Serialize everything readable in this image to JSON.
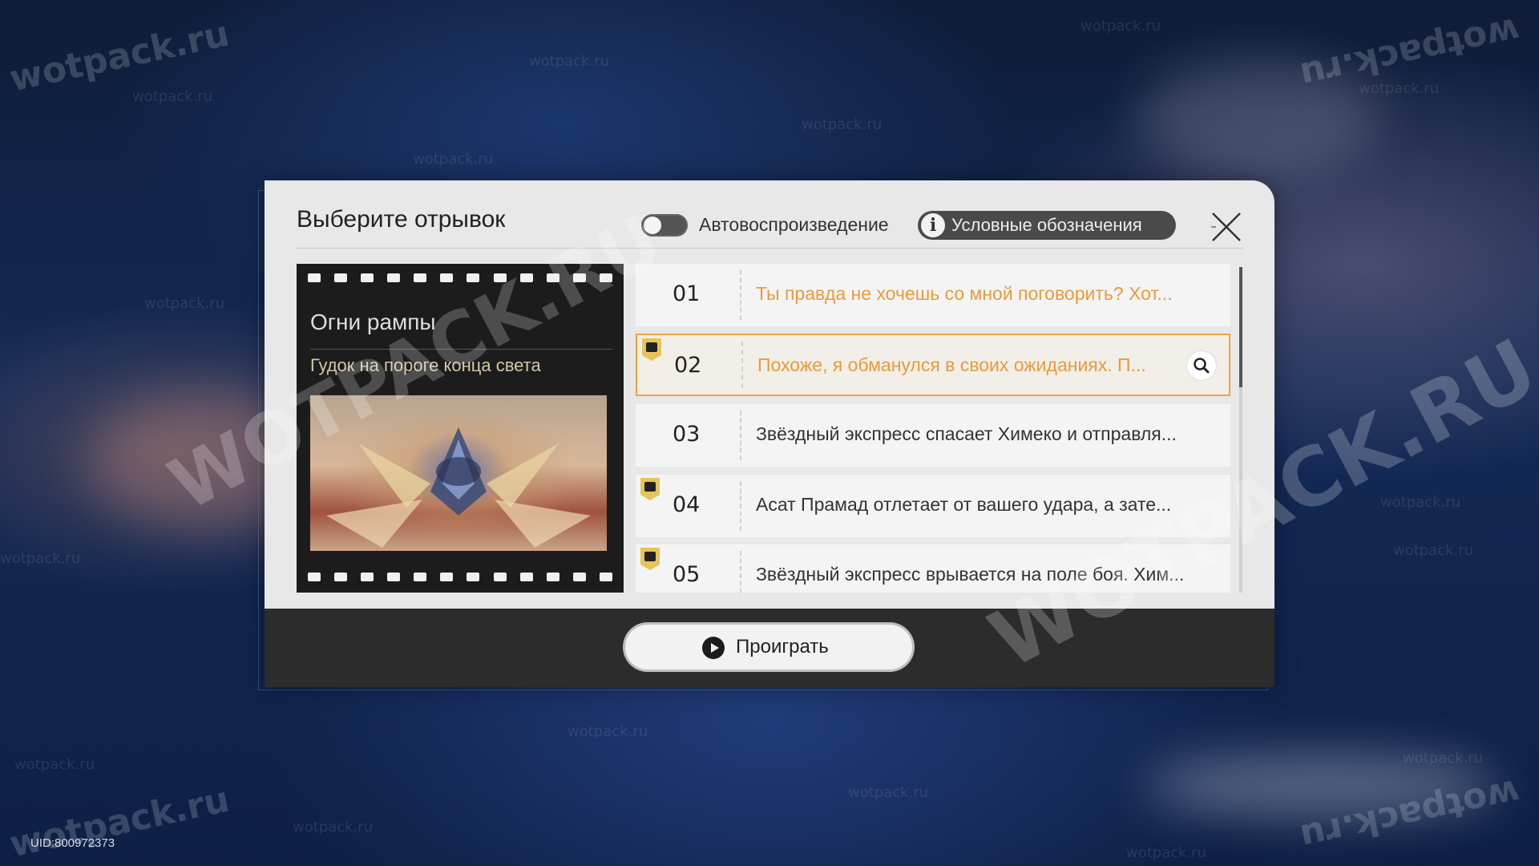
{
  "dialog": {
    "title": "Выберите отрывок",
    "autoplay_label": "Автовоспроизведение",
    "autoplay_on": false,
    "legend_label": "Условные обозначения",
    "legend_icon": "info-icon",
    "close_icon": "close-icon"
  },
  "film": {
    "title": "Огни рампы",
    "subtitle": "Гудок на пороге конца света"
  },
  "segments": [
    {
      "num": "01",
      "text": "Ты правда не хочешь со мной поговорить? Хот...",
      "state": "watched",
      "icon": ""
    },
    {
      "num": "02",
      "text": "Похоже, я обманулся в своих ожиданиях. П...",
      "state": "selected",
      "icon": "image-icon"
    },
    {
      "num": "03",
      "text": "Звёздный экспресс спасает Химеко и отправля...",
      "state": "normal",
      "icon": ""
    },
    {
      "num": "04",
      "text": "Асат Прамад отлетает от вашего удара, а зате...",
      "state": "normal",
      "icon": "video-icon"
    },
    {
      "num": "05",
      "text": "Звёздный экспресс врывается на поле боя. Хим...",
      "state": "normal",
      "icon": "video-icon"
    }
  ],
  "play_button": {
    "label": "Проиграть",
    "icon": "play-icon"
  },
  "uid": "UID:800972373",
  "watermark": "wotpack.ru",
  "watermark_big": "WOTPACK.RU",
  "colors": {
    "accent": "#f0a33f",
    "orange_text": "#e89a3c",
    "panel": "#e8e8e8",
    "bar": "#2c2c2c"
  }
}
